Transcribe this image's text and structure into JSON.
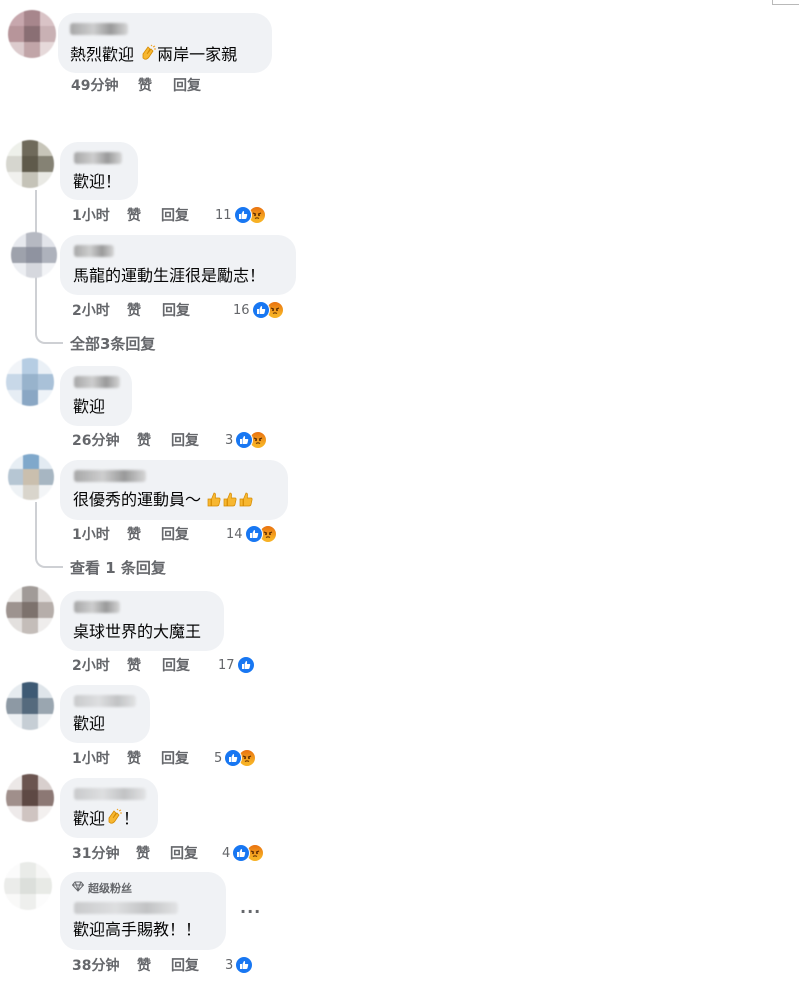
{
  "comments": [
    {
      "text": "熱烈歡迎 ",
      "text2": "兩岸一家親",
      "time": "49分钟",
      "like": "赞",
      "reply": "回复"
    },
    {
      "text": "歡迎！",
      "time": "1小时",
      "like": "赞",
      "reply": "回复",
      "count": "11"
    },
    {
      "text": "馬龍的運動生涯很是勵志！",
      "time": "2小时",
      "like": "赞",
      "reply": "回复",
      "count": "16"
    },
    {
      "text": "歡迎",
      "time": "26分钟",
      "like": "赞",
      "reply": "回复",
      "count": "3"
    },
    {
      "text": "很優秀的運動員～",
      "time": "1小时",
      "like": "赞",
      "reply": "回复",
      "count": "14"
    },
    {
      "text": "桌球世界的大魔王",
      "time": "2小时",
      "like": "赞",
      "reply": "回复",
      "count": "17"
    },
    {
      "text": "歡迎",
      "time": "1小时",
      "like": "赞",
      "reply": "回复",
      "count": "5"
    },
    {
      "text": "歡迎",
      "text2": "！",
      "time": "31分钟",
      "like": "赞",
      "reply": "回复",
      "count": "4"
    },
    {
      "badge": "超级粉丝",
      "text": "歡迎高手賜教！！",
      "time": "38分钟",
      "like": "赞",
      "reply": "回复",
      "count": "3",
      "more": "···"
    }
  ],
  "thread_links": [
    "全部3条回复",
    "查看 1 条回复"
  ],
  "icons": {
    "like": "like-icon",
    "angry": "angry-icon",
    "clap": "clap-emoji",
    "thumb": "thumbs-up-emoji",
    "diamond": "diamond-icon"
  },
  "colors": {
    "like_blue": "#1877f2",
    "bubble_bg": "#f0f2f5",
    "meta_gray": "#65676b"
  }
}
